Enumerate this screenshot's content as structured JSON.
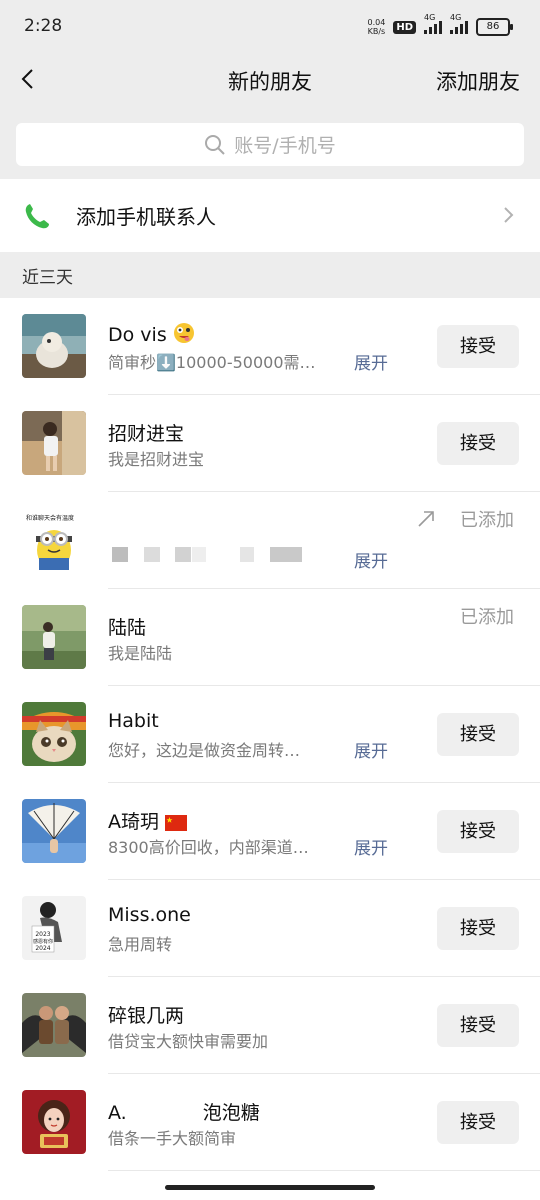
{
  "status_bar": {
    "time": "2:28",
    "speed_value": "0.04",
    "speed_unit": "KB/s",
    "hd": "HD",
    "network_1": "4G",
    "network_2": "4G",
    "battery": "86"
  },
  "nav": {
    "title": "新的朋友",
    "add_friend": "添加朋友"
  },
  "search": {
    "placeholder": "账号/手机号"
  },
  "phone_contacts": {
    "label": "添加手机联系人"
  },
  "section": {
    "label": "近三天"
  },
  "colors": {
    "accent_link": "#576b95",
    "phone_green": "#3cb94a",
    "background": "#ededed"
  },
  "friends": [
    {
      "name": "Do vis",
      "message": "简审秒⬇️10000-50000需…",
      "expand": "展开",
      "action": "接受"
    },
    {
      "name": "招财进宝",
      "message": "我是招财进宝",
      "action": "接受"
    },
    {
      "name": "",
      "expand": "展开",
      "status": "已添加"
    },
    {
      "name": "陆陆",
      "message": "我是陆陆",
      "status": "已添加"
    },
    {
      "name": "Habit",
      "message": "您好，这边是做资金周转…",
      "expand": "展开",
      "action": "接受"
    },
    {
      "name": "A琦玥",
      "message": "8300高价回收，内部渠道…",
      "expand": "展开",
      "action": "接受"
    },
    {
      "name": "Miss.one",
      "message": "急用周转",
      "action": "接受"
    },
    {
      "name": "碎银几两",
      "message": "借贷宝大额快审需要加",
      "action": "接受"
    },
    {
      "name": "A.　　　　泡泡糖",
      "message": "借条一手大额简审",
      "action": "接受"
    }
  ],
  "avatar_text": {
    "minion_caption": "和谁聊天会有温度",
    "year_card": "2023 感恩有你 2024 请多关照"
  }
}
